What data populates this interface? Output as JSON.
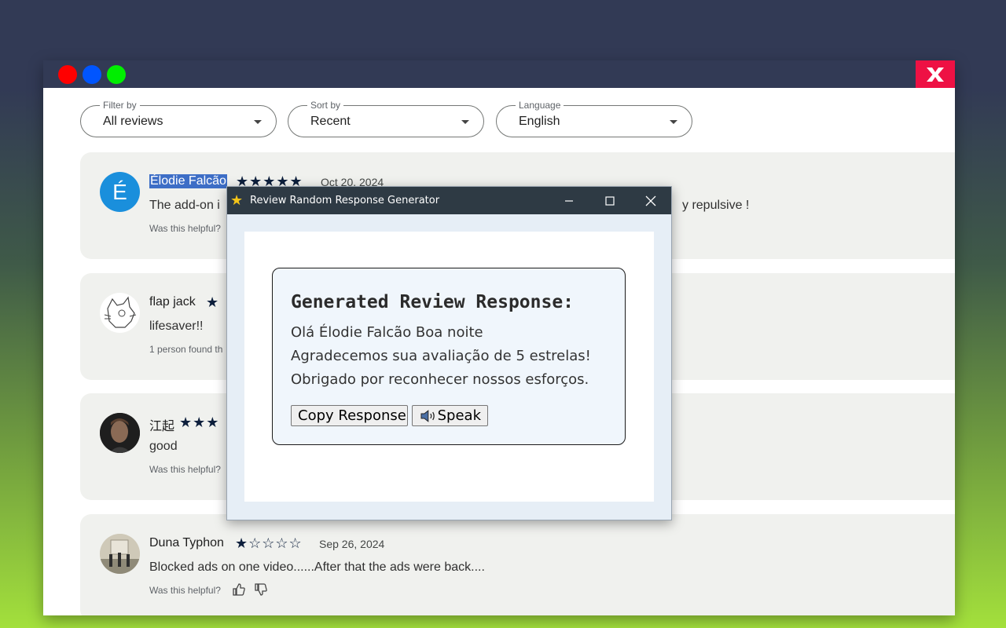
{
  "window": {
    "controls": [
      "red-dot",
      "blue-dot",
      "green-dot"
    ],
    "close_icon": "x-icon"
  },
  "filters": [
    {
      "label": "Filter by",
      "value": "All reviews"
    },
    {
      "label": "Sort by",
      "value": "Recent"
    },
    {
      "label": "Language",
      "value": "English"
    }
  ],
  "reviews": [
    {
      "avatar_letter": "É",
      "name": "Élodie Falcão",
      "stars": "★★★★★",
      "date": "Oct 20, 2024",
      "text_start": "The add-on i",
      "text_end": "y repulsive !",
      "helpful": "Was this helpful?"
    },
    {
      "name": "flap jack",
      "stars": "★",
      "text": "lifesaver!!",
      "helpful": "1 person found th"
    },
    {
      "name": "江起",
      "stars": "★★★",
      "text": "good",
      "helpful": "Was this helpful?"
    },
    {
      "name": "Duna Typhon",
      "stars": "★☆☆☆☆",
      "date": "Sep 26, 2024",
      "text": "Blocked ads on one video......After that the ads were back....",
      "helpful": "Was this helpful?"
    }
  ],
  "dialog": {
    "title": "Review Random Response Generator",
    "title_icon": "star-icon",
    "minimize": "—",
    "maximize": "☐",
    "close": "✕",
    "heading": "Generated Review Response:",
    "lines": [
      "Olá Élodie Falcão Boa noite",
      "Agradecemos sua avaliação de 5 estrelas!",
      "Obrigado por reconhecer nossos esforços."
    ],
    "copy_button": "Copy Response",
    "speak_button": "Speak",
    "speak_icon": "speaker-icon"
  },
  "colors": {
    "titlebar": "#323a55",
    "close_red": "#ee1144",
    "card_bg": "#f0f1ee",
    "star": "#0d1f3c",
    "selection": "#3d6ec6",
    "dialog_title": "#2e3a44"
  }
}
